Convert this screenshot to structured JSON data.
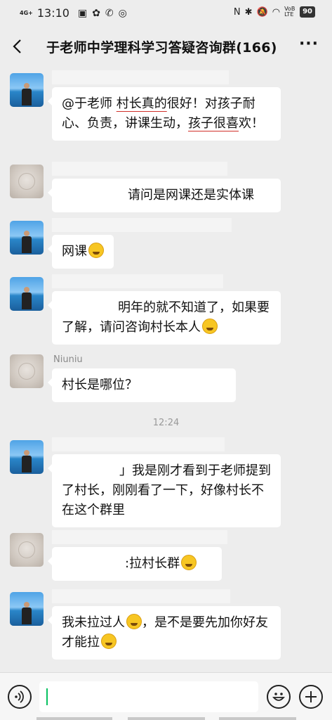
{
  "status_bar": {
    "network": "4G+",
    "time": "13:10",
    "battery": "90",
    "volte": "VoB LTE"
  },
  "nav": {
    "title": "于老师中学理科学习答疑咨询群(166)",
    "more": "···"
  },
  "messages": [
    {
      "avatar": "photo",
      "text_a": "@于老师 ",
      "text_b": "村长真的",
      "text_c": "很好！对孩子耐心、负责，讲课生动，",
      "text_d": "孩子很喜",
      "text_e": "欢！"
    },
    {
      "avatar": "cat",
      "text": "请问是网课还是实体课"
    },
    {
      "avatar": "photo",
      "text": "网课"
    },
    {
      "avatar": "photo",
      "text": "明年的就不知道了，如果要了解，请问咨询村长本人"
    },
    {
      "avatar": "cat",
      "nickname": "Niuniu",
      "text": "村长是哪位？"
    },
    {
      "avatar": "photo",
      "text": "」我是刚才看到于老师提到了村长，刚刚看了一下，好像村长不在这个群里"
    },
    {
      "avatar": "cat",
      "text": ":拉村长群"
    },
    {
      "avatar": "photo",
      "text_a": "我未拉过人",
      "text_b": "，是不是要先加你好友才能拉"
    }
  ],
  "timestamp": "12:24",
  "input": {
    "value": "",
    "placeholder": ""
  },
  "icons": [
    "back-icon",
    "more-icon",
    "voice-icon",
    "emoji-icon",
    "plus-icon",
    "grin-emoji",
    "smile-emoji",
    "cry-laugh-emoji"
  ]
}
